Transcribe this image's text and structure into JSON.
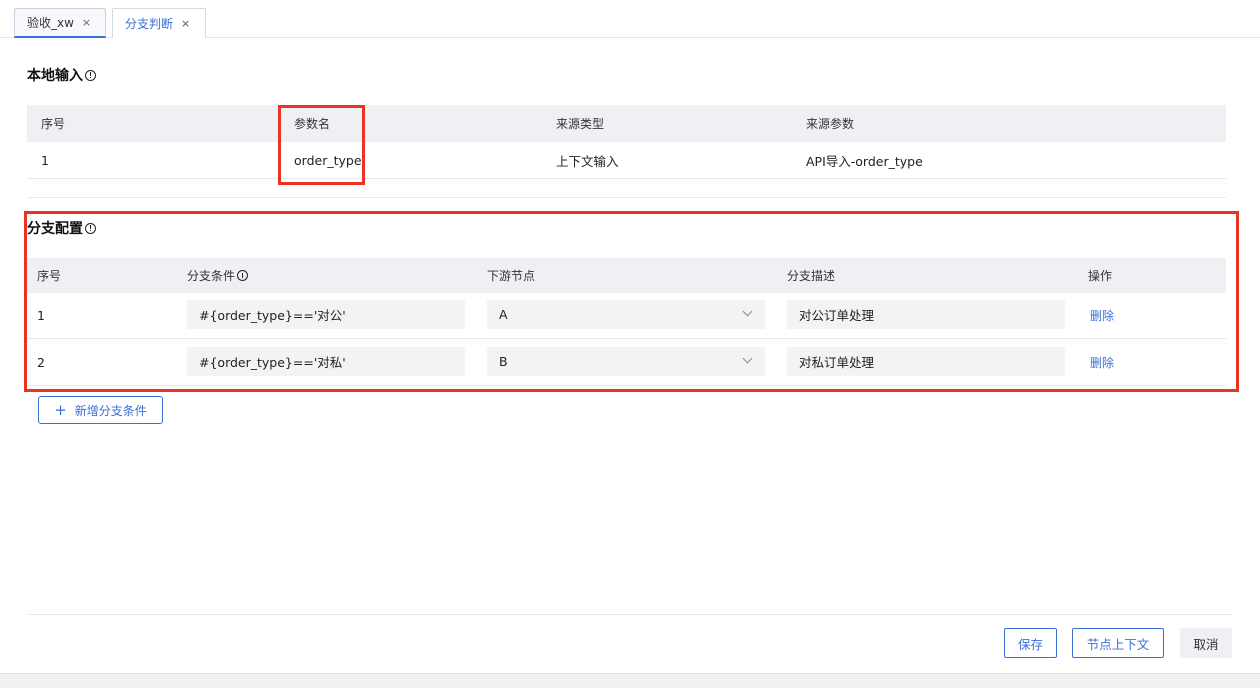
{
  "tabs": [
    {
      "label": "验收_xw",
      "close": "×"
    },
    {
      "label": "分支判断",
      "close": "×"
    }
  ],
  "local_input": {
    "title": "本地输入",
    "columns": [
      "序号",
      "参数名",
      "来源类型",
      "来源参数"
    ],
    "rows": [
      {
        "index": "1",
        "param": "order_type",
        "source_type": "上下文输入",
        "source_param": "API导入-order_type"
      }
    ]
  },
  "branch_config": {
    "title": "分支配置",
    "columns": [
      "序号",
      "分支条件",
      "下游节点",
      "分支描述",
      "操作"
    ],
    "rows": [
      {
        "index": "1",
        "condition": "#{order_type}=='对公'",
        "node": "A",
        "desc": "对公订单处理",
        "action": "删除"
      },
      {
        "index": "2",
        "condition": "#{order_type}=='对私'",
        "node": "B",
        "desc": "对私订单处理",
        "action": "删除"
      }
    ],
    "add_label": "新增分支条件"
  },
  "footer": {
    "save": "保存",
    "context": "节点上下文",
    "cancel": "取消"
  },
  "colors": {
    "accent": "#3a6fd8",
    "highlight": "#ea3323",
    "header_bg": "#eef0f3"
  }
}
